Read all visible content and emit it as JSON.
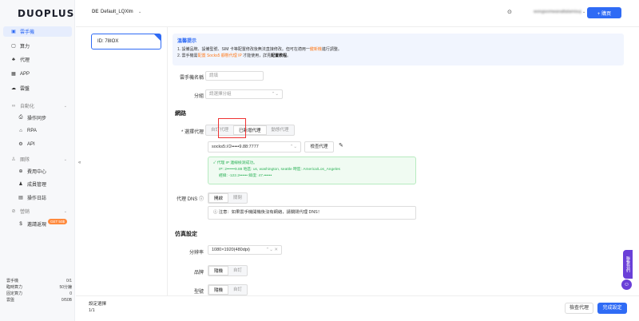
{
  "brand": {
    "logo_text": "DUOPLUS"
  },
  "sidebar": {
    "items": [
      {
        "label": "雲手機",
        "icon": "phone-icon",
        "glyph": "▣"
      },
      {
        "label": "算力",
        "icon": "cpu-icon",
        "glyph": "▢"
      },
      {
        "label": "代理",
        "icon": "network-icon",
        "glyph": "♣"
      },
      {
        "label": "APP",
        "icon": "grid-icon",
        "glyph": "▦"
      },
      {
        "label": "雲盤",
        "icon": "cloud-icon",
        "glyph": "☁"
      },
      {
        "label": "自動化",
        "icon": "automation-icon",
        "glyph": "∞"
      },
      {
        "label": "操作同步",
        "icon": "sync-icon",
        "glyph": "⎙"
      },
      {
        "label": "RPA",
        "icon": "rpa-icon",
        "glyph": "⌂"
      },
      {
        "label": "API",
        "icon": "api-icon",
        "glyph": "⚙"
      },
      {
        "label": "團隊",
        "icon": "team-icon",
        "glyph": "♙"
      },
      {
        "label": "費用中心",
        "icon": "billing-icon",
        "glyph": "⊕"
      },
      {
        "label": "成員管理",
        "icon": "members-icon",
        "glyph": "♟"
      },
      {
        "label": "操作日誌",
        "icon": "log-icon",
        "glyph": "▤"
      },
      {
        "label": "營銷",
        "icon": "marketing-icon",
        "glyph": "⊘"
      },
      {
        "label": "邀請返現",
        "icon": "dollar-icon",
        "glyph": "$"
      }
    ],
    "new_badge": "GET 50$",
    "collapse_glyph": "«",
    "stats": [
      {
        "label": "雲手機",
        "value": "0/1"
      },
      {
        "label": "臨時算力",
        "value": "50分鐘"
      },
      {
        "label": "固定算力",
        "value": "0"
      },
      {
        "label": "雲盤",
        "value": "0/50B"
      }
    ]
  },
  "topbar": {
    "profile_tag": "DE",
    "profile_name": "Default_LQXlm",
    "account": "wongsomwanaltalamisuj...",
    "add_button": "+ 購買"
  },
  "device": {
    "label": "ID: 78IOX"
  },
  "tips": {
    "title": "溫馨提示",
    "line1_a": "1. 設備品牌、設備型號、SIM 卡等配置修改後無法直接修改。但可在適用一",
    "line1_orange": "鍵新機",
    "line1_b": "進行調整。",
    "line2_a": "2. 雲手機需",
    "line2_orange": "配置 Socks5 靜態代理 IP",
    "line2_b": " 才能使用，詳見",
    "line2_bold": "配置教程",
    "line2_c": "。"
  },
  "form": {
    "name_label": "雲手機名稱",
    "name_placeholder": "請填",
    "group_label": "分組",
    "group_placeholder": "請選擇分組",
    "network_title": "網路",
    "proxy_label": "* 選擇代理",
    "proxy_options": [
      "自訂代理",
      "已新增代理",
      "動態代理"
    ],
    "proxy_value": "socks5://2•••••9.88:7777",
    "check_button": "檢查代理",
    "success_lines": [
      "代理 IP 連線檢測成功。",
      "IP: 2••••••9.88 地區: us, washington, seattle 時區: America/Los_Angeles",
      "經緯: -122.2•••••• 緯度: 47.••••••"
    ],
    "dns_label": "代理 DNS",
    "dns_options": [
      "開啟",
      "關閉"
    ],
    "dns_note": "注意：如果雲手機開機後沒有網絡，請關閉代理 DNS！",
    "sim_title": "仿真設定",
    "resolution_label": "分辨率",
    "resolution_value": "1080×1920(480dpi)",
    "brand_label": "品牌",
    "brand_options": [
      "隨機",
      "自訂"
    ],
    "model_label": "型號",
    "model_options": [
      "隨機",
      "自訂"
    ]
  },
  "footer": {
    "selected_label": "設定選擇",
    "selected_count": "1/1",
    "check_proxy": "檢查代理",
    "finish": "完成設定"
  },
  "floating": {
    "tab_label": "聯繫我們"
  }
}
